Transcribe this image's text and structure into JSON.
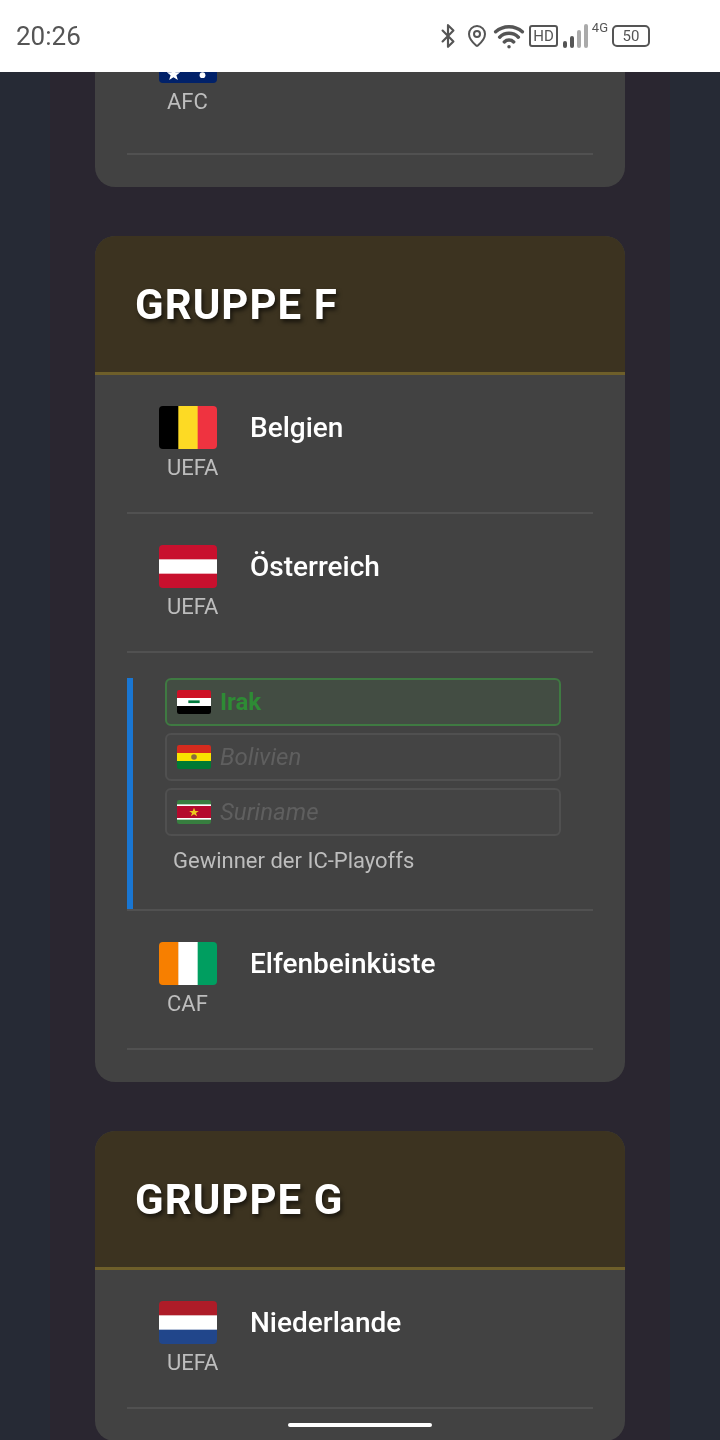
{
  "status_bar": {
    "time": "20:26",
    "hd": "HD",
    "network": "4G",
    "battery": "50"
  },
  "partial_group": {
    "teams": [
      {
        "flag": {
          "kind": "au"
        },
        "confederation": "AFC"
      }
    ]
  },
  "groups": [
    {
      "title": "GRUPPE F",
      "teams": [
        {
          "kind": "team",
          "flag": {
            "kind": "be"
          },
          "name": "Belgien",
          "confederation": "UEFA"
        },
        {
          "kind": "team",
          "flag": {
            "kind": "at"
          },
          "name": "Österreich",
          "confederation": "UEFA"
        },
        {
          "kind": "playoff",
          "caption": "Gewinner der IC-Playoffs",
          "options": [
            {
              "flag": {
                "kind": "iq"
              },
              "name": "Irak",
              "selected": true
            },
            {
              "flag": {
                "kind": "bo"
              },
              "name": "Bolivien",
              "selected": false
            },
            {
              "flag": {
                "kind": "sr"
              },
              "name": "Suriname",
              "selected": false
            }
          ]
        },
        {
          "kind": "team",
          "flag": {
            "kind": "ci"
          },
          "name": "Elfenbeinküste",
          "confederation": "CAF"
        }
      ]
    },
    {
      "title": "GRUPPE G",
      "teams": [
        {
          "kind": "team",
          "flag": {
            "kind": "nl"
          },
          "name": "Niederlande",
          "confederation": "UEFA"
        }
      ]
    }
  ]
}
